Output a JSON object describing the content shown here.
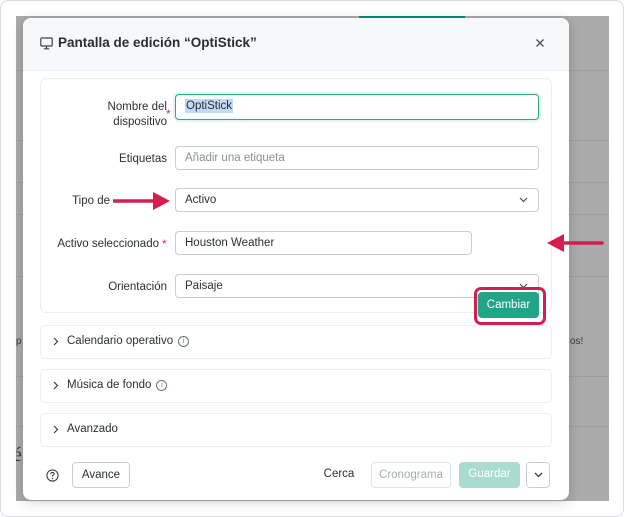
{
  "dialog": {
    "title": "Pantalla de edición  “OptiStick”",
    "monitor_icon": "monitor-icon",
    "close_icon": "close-icon"
  },
  "form": {
    "device_name": {
      "label_line1": "Nombre del",
      "label_line2": "dispositivo",
      "required_mark": "*",
      "value": "OptiStick"
    },
    "tags": {
      "label": "Etiquetas",
      "placeholder": "Añadir una etiqueta"
    },
    "type": {
      "label": "Tipo de",
      "value": "Activo"
    },
    "selected_asset": {
      "label": "Activo seleccionado",
      "required_mark": "*",
      "value": "Houston Weather",
      "change_button": "Cambiar"
    },
    "orientation": {
      "label": "Orientación",
      "value": "Paisaje"
    }
  },
  "sections": [
    {
      "label": "Calendario operativo",
      "has_info": true
    },
    {
      "label": "Música de fondo",
      "has_info": true
    },
    {
      "label": "Avanzado",
      "has_info": false
    }
  ],
  "footer": {
    "help_icon": "help-circle-icon",
    "advanced_button": "Avance",
    "close_button": "Cerca",
    "schedule_button": "Cronograma",
    "save_button": "Guardar",
    "more_icon": "chevron-down-icon"
  },
  "background": {
    "left_fragment": "p",
    "right_fragment": "os!",
    "bottom_fragment": "é"
  },
  "colors": {
    "accent": "#21a488",
    "annotation": "#d61d4f",
    "required": "#d9324e"
  }
}
